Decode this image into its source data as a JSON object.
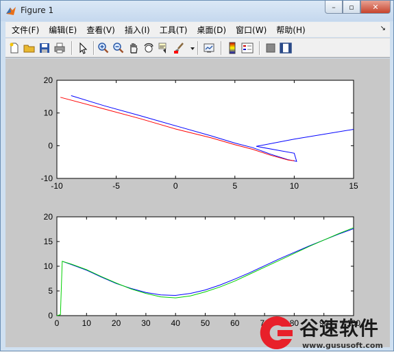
{
  "window": {
    "title": "Figure 1",
    "min": "–",
    "max": "▫",
    "close": "✕"
  },
  "menu": [
    "文件(F)",
    "编辑(E)",
    "查看(V)",
    "插入(I)",
    "工具(T)",
    "桌面(D)",
    "窗口(W)",
    "帮助(H)"
  ],
  "menu_extra": "↘",
  "toolbar": {
    "icons": [
      "new-figure-icon",
      "open-file-icon",
      "save-icon",
      "print-icon",
      "arrow-pointer-icon",
      "zoom-in-icon",
      "zoom-out-icon",
      "pan-hand-icon",
      "rotate-3d-icon",
      "data-cursor-icon",
      "brush-icon",
      "brush-dropdown-icon",
      "link-plot-icon",
      "colorbar-icon",
      "legend-icon",
      "hide-plot-tools-icon",
      "show-plot-tools-icon"
    ]
  },
  "colors": {
    "series_blue": "#0000ff",
    "series_red": "#ff0000",
    "series_green": "#00d000",
    "axes_bg": "#ffffff",
    "figure_bg": "#c8c8c8"
  },
  "chart_data": [
    {
      "type": "line",
      "xlim": [
        -10,
        15
      ],
      "ylim": [
        -10,
        20
      ],
      "xticks": [
        "-10",
        "-5",
        "0",
        "5",
        "10",
        "15"
      ],
      "yticks": [
        "-10",
        "0",
        "10",
        "20"
      ],
      "xtick_values": [
        -10,
        -5,
        0,
        5,
        10,
        15
      ],
      "ytick_values": [
        -10,
        0,
        10,
        20
      ],
      "series": [
        {
          "color": "blue",
          "x": [
            -8.8,
            -6,
            -3,
            0,
            3,
            5,
            6.5,
            8,
            9.5,
            10.2,
            10,
            6.8,
            10,
            15
          ],
          "y": [
            15.3,
            12.2,
            9.2,
            6.1,
            3.0,
            0.8,
            -0.6,
            -2.6,
            -4.3,
            -4.8,
            -2.3,
            -0.2,
            2.0,
            5.0
          ]
        },
        {
          "color": "red",
          "x": [
            -9.7,
            -6,
            -3,
            0,
            3,
            5,
            6.5,
            8,
            9.5,
            10
          ],
          "y": [
            14.8,
            11.2,
            8.3,
            5.1,
            2.4,
            0.3,
            -1.1,
            -2.9,
            -4.4,
            -4.6
          ]
        }
      ]
    },
    {
      "type": "line",
      "xlim": [
        0,
        100
      ],
      "ylim": [
        0,
        20
      ],
      "xticks": [
        "0",
        "10",
        "20",
        "30",
        "40",
        "50",
        "60",
        "70",
        "80",
        "90",
        "100"
      ],
      "yticks": [
        "0",
        "5",
        "10",
        "15",
        "20"
      ],
      "xtick_values": [
        0,
        10,
        20,
        30,
        40,
        50,
        60,
        70,
        80,
        90,
        100
      ],
      "ytick_values": [
        0,
        5,
        10,
        15,
        20
      ],
      "series": [
        {
          "color": "blue",
          "x": [
            1.8,
            5,
            10,
            15,
            20,
            25,
            30,
            35,
            40,
            45,
            50,
            55,
            60,
            65,
            70,
            75,
            80,
            85,
            90,
            95,
            100
          ],
          "y": [
            11.0,
            10.3,
            9.2,
            7.8,
            6.5,
            5.5,
            4.7,
            4.2,
            4.1,
            4.5,
            5.2,
            6.2,
            7.4,
            8.7,
            10.1,
            11.5,
            12.8,
            14.1,
            15.3,
            16.5,
            17.6
          ]
        },
        {
          "color": "green",
          "x": [
            0,
            1.2,
            1.8,
            5,
            10,
            15,
            20,
            25,
            30,
            35,
            40,
            45,
            50,
            55,
            60,
            65,
            70,
            75,
            80,
            85,
            90,
            95,
            100
          ],
          "y": [
            0,
            0.2,
            11.0,
            10.4,
            9.3,
            7.9,
            6.6,
            5.4,
            4.5,
            3.8,
            3.6,
            4.0,
            4.8,
            5.8,
            7.0,
            8.4,
            9.8,
            11.2,
            12.6,
            14.0,
            15.3,
            16.6,
            17.8
          ]
        }
      ]
    }
  ],
  "watermark": {
    "title": "谷速软件",
    "url": "www.gususoft.com"
  }
}
